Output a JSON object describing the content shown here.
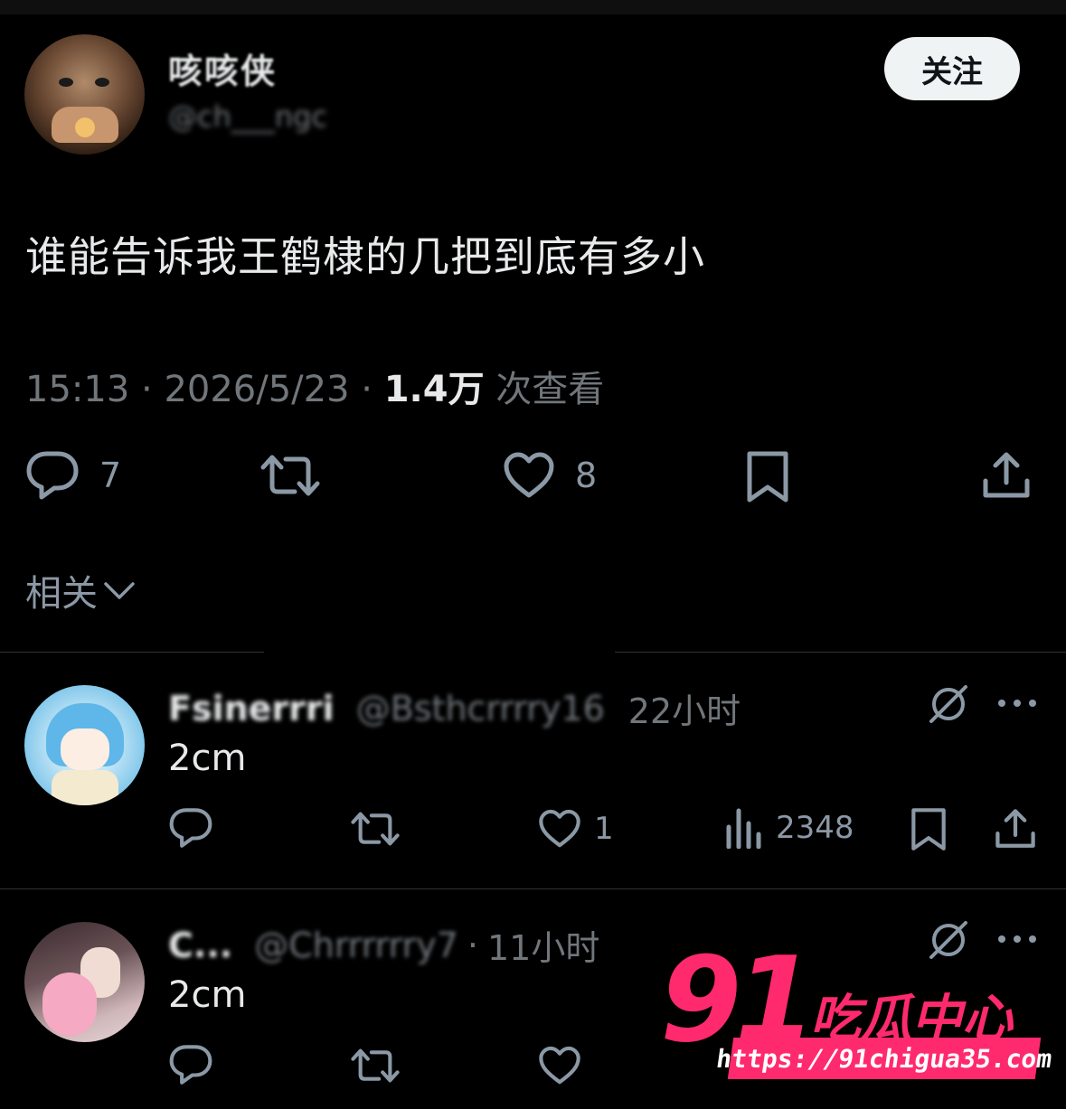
{
  "post": {
    "display_name": "咳咳侠",
    "handle": "@ch___ngc",
    "follow_label": "关注",
    "text": "谁能告诉我王鹤棣的几把到底有多小",
    "time": "15:13",
    "date": "2026/5/23",
    "views": "1.4万",
    "views_suffix": "次查看",
    "meta_sep": "·",
    "actions": {
      "reply_count": "7",
      "like_count": "8"
    }
  },
  "related": {
    "label": "相关"
  },
  "replies": [
    {
      "name": "Fsinerrri",
      "handle": "@Bsthcrrrry16",
      "time": "22小时",
      "text": "2cm",
      "likes": "1",
      "views": "2348"
    },
    {
      "name": "C...",
      "handle": "@Chrrrrrry7",
      "time": "11小时",
      "time_sep": "·",
      "text": "2cm"
    }
  ],
  "watermark": {
    "number": "91",
    "title": "吃瓜中心",
    "url": "https://91chigua35.com"
  },
  "colors": {
    "background": "#000000",
    "text": "#e7e9ea",
    "muted": "#71767b",
    "icon": "#8b98a5",
    "watermark": "#ff2a6d"
  },
  "icons": [
    "reply-icon",
    "retweet-icon",
    "heart-icon",
    "bookmark-icon",
    "share-icon",
    "chevron-down-icon",
    "grok-icon",
    "more-icon",
    "views-icon"
  ]
}
